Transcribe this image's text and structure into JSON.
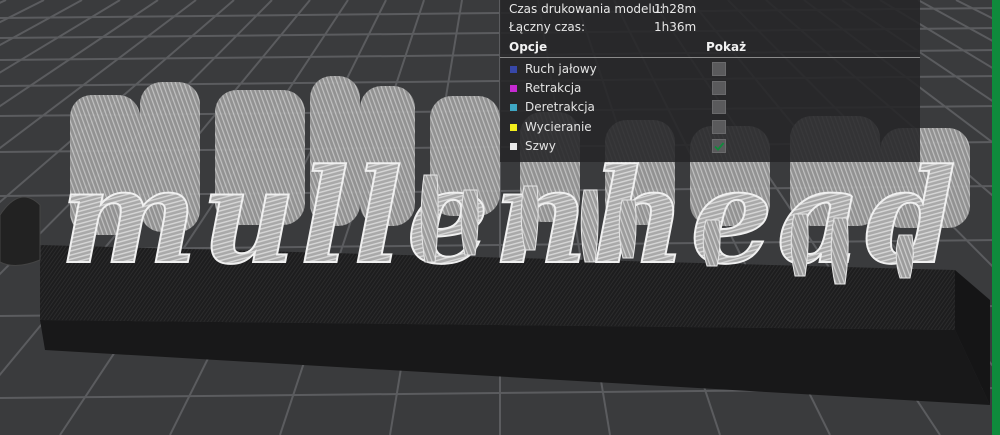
{
  "legend": {
    "stats": [
      {
        "label": "Czas drukowania modelu:",
        "value": "1h28m"
      },
      {
        "label": "Łączny czas:",
        "value": "1h36m"
      }
    ],
    "header_options": "Opcje",
    "header_show": "Pokaż",
    "options": [
      {
        "label": "Ruch jałowy",
        "color": "#3747a8",
        "checked": false
      },
      {
        "label": "Retrakcja",
        "color": "#c62ad2",
        "checked": false
      },
      {
        "label": "Deretrakcja",
        "color": "#3fa7c4",
        "checked": false
      },
      {
        "label": "Wycieranie",
        "color": "#f3ee1c",
        "checked": false
      },
      {
        "label": "Szwy",
        "color": "#e8e8e8",
        "checked": true
      }
    ]
  },
  "viewport": {
    "model_text": "mullenhead",
    "bed_color": "#3a3b3d",
    "grid_color": "#5a5b5e",
    "base_color": "#1e1e1f",
    "print_color": "#b9b9b9"
  },
  "accent_color": "#0f8a3c"
}
